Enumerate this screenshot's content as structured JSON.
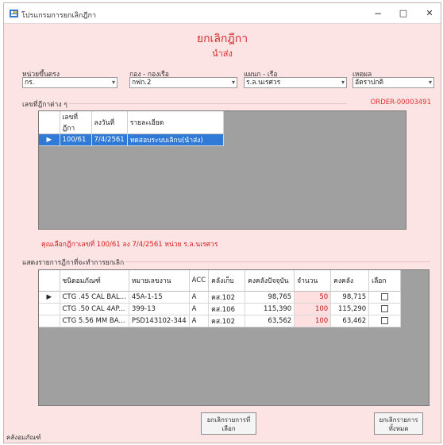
{
  "window": {
    "title": "โปรแกรมการยกเลิกฎีกา",
    "minimize": "−",
    "maximize": "□",
    "close": "✕"
  },
  "header": {
    "title": "ยกเลิกฎีกา",
    "subtitle": "นำส่ง"
  },
  "filters": {
    "unit_label": "หน่วยขึ้นตรง",
    "unit_value": "กร.",
    "division_label": "กอง - กองเรือ",
    "division_value": "กฟก.2",
    "dept_label": "แผนก - เรือ",
    "dept_value": "ร.ล.นเรศวร",
    "reason_label": "เหตุผล",
    "reason_value": "อัตราปกติ"
  },
  "order_number": "ORDER-00003491",
  "top_section": {
    "label": "เลขที่ฎีกาต่าง ๆ",
    "columns": [
      "เลขที่ฎีกา",
      "ลงวันที่",
      "รายละเอียด"
    ],
    "rows": [
      {
        "number": "100/61",
        "date": "7/4/2561",
        "detail": "ทดสอบระบบเลิกบ(นำส่ง)"
      }
    ]
  },
  "info_line": "คุณเลือกฎีกาเลขที่ 100/61 ลง 7/4/2561 หน่วย ร.ล.นเรศวร",
  "bottom_section": {
    "label": "แสดงรายการฎีกาที่จะทำการยกเลิก",
    "columns": [
      "ชนิดอมภัณฑ์",
      "หมายเลขงาน",
      "ACC",
      "คลังเก็บ",
      "คงคลังปัจจุบัน",
      "จำนวน",
      "คงคลัง",
      "เลือก"
    ],
    "rows": [
      {
        "type": "CTG .45 CAL BAL...",
        "job": "45A-1-15",
        "acc": "A",
        "store": "คส.102",
        "stock": "98,765",
        "qty": "50",
        "remain": "98,715"
      },
      {
        "type": "CTG .50 CAL 4AP...",
        "job": "399-13",
        "acc": "A",
        "store": "คส.106",
        "stock": "115,390",
        "qty": "100",
        "remain": "115,290"
      },
      {
        "type": "CTG 5.56 MM BA...",
        "job": "PSD143102-344",
        "acc": "A",
        "store": "คส.102",
        "stock": "63,562",
        "qty": "100",
        "remain": "63,462"
      }
    ]
  },
  "buttons": {
    "cancel_selected": "ยกเลิกรายการที่เลือก",
    "cancel_all": "ยกเลิกรายการทั้งหมด"
  },
  "status": "คลังอมภัณฑ์",
  "colors": {
    "background": "#fde4e4",
    "accent_red": "#d62b2b",
    "selection": "#2f7ad6",
    "grid_empty": "#a0a0a0"
  }
}
